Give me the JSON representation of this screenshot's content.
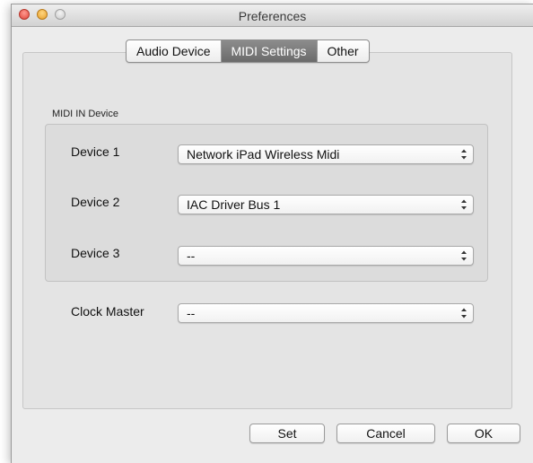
{
  "window": {
    "title": "Preferences"
  },
  "tabs": [
    {
      "label": "Audio Device",
      "active": false
    },
    {
      "label": "MIDI Settings",
      "active": true
    },
    {
      "label": "Other",
      "active": false
    }
  ],
  "midi_in": {
    "group_label": "MIDI IN Device",
    "devices": [
      {
        "label": "Device 1",
        "value": "Network iPad Wireless Midi"
      },
      {
        "label": "Device 2",
        "value": "IAC Driver Bus 1"
      },
      {
        "label": "Device 3",
        "value": "--"
      }
    ]
  },
  "clock_master": {
    "label": "Clock Master",
    "value": "--"
  },
  "buttons": {
    "set": "Set",
    "cancel": "Cancel",
    "ok": "OK"
  },
  "icons": {
    "close": "close-icon",
    "minimize": "minimize-icon",
    "zoom": "zoom-icon",
    "popup_arrows": "up-down-arrows-icon"
  },
  "colors": {
    "window_bg": "#ececec",
    "active_tab": "#7a7a7a",
    "close": "#e0443a",
    "minimize": "#e6a02b"
  }
}
